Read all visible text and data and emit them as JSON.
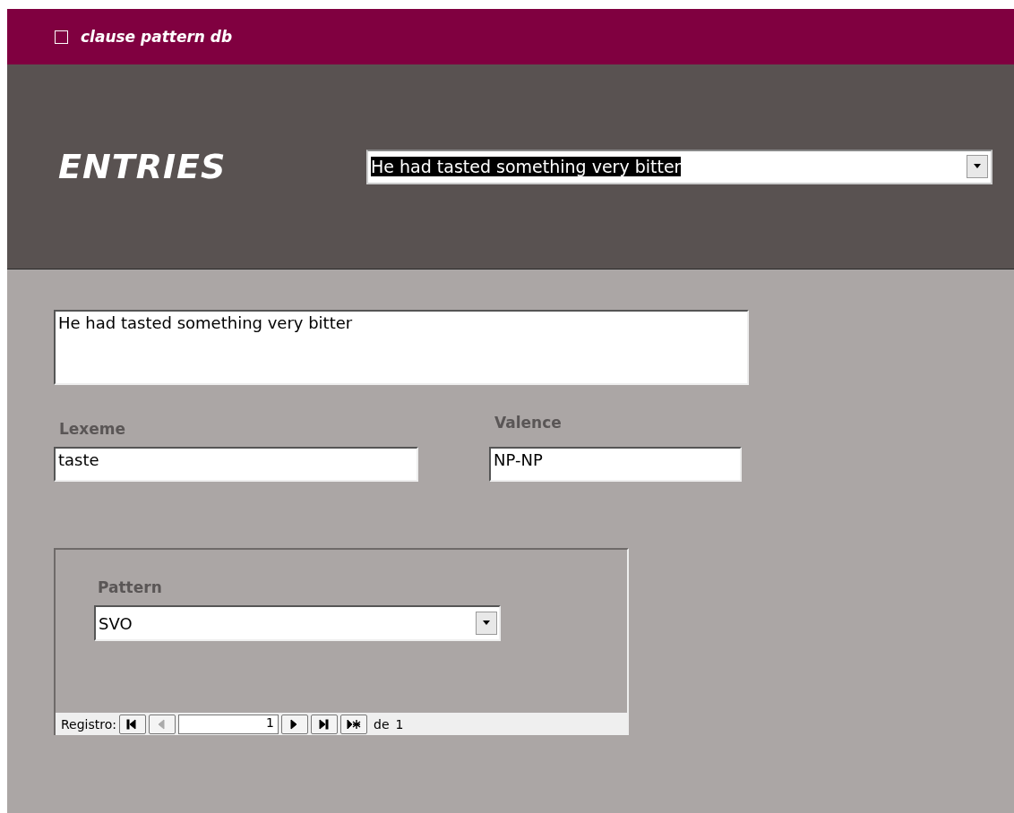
{
  "title_bar": {
    "title": "clause pattern db"
  },
  "header": {
    "heading": "ENTRIES",
    "record_combo": {
      "value": "He had tasted something very bitter"
    }
  },
  "sentence": {
    "value": "He had tasted something very bitter"
  },
  "lexeme": {
    "label": "Lexeme",
    "value": "taste"
  },
  "valence": {
    "label": "Valence",
    "value": "NP-NP"
  },
  "subform": {
    "pattern": {
      "label": "Pattern",
      "value": "SVO"
    },
    "navigator": {
      "label": "Registro:",
      "current": "1",
      "of_label": "de",
      "total": "1",
      "buttons": [
        {
          "kind": "first",
          "disabled": false
        },
        {
          "kind": "prev",
          "disabled": true
        },
        {
          "kind": "next",
          "disabled": false
        },
        {
          "kind": "last",
          "disabled": false
        },
        {
          "kind": "new",
          "disabled": false
        }
      ]
    }
  }
}
